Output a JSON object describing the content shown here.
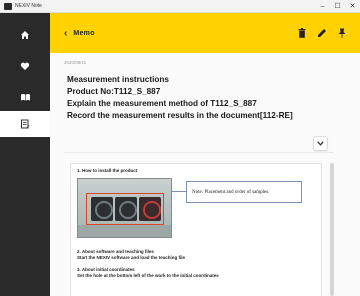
{
  "window": {
    "title": "NEXIV Note",
    "controls": {
      "minimize": "–",
      "maximize": "☐",
      "close": "✕"
    }
  },
  "sidebar": {
    "items": [
      {
        "name": "home",
        "icon": "home-icon",
        "active": false
      },
      {
        "name": "favorites",
        "icon": "heart-icon",
        "active": false
      },
      {
        "name": "library",
        "icon": "books-icon",
        "active": false
      },
      {
        "name": "memo",
        "icon": "memo-icon",
        "active": true
      }
    ]
  },
  "header": {
    "back_icon": "‹",
    "title": "Memo",
    "background": "#ffd200",
    "actions": [
      "trash-icon",
      "edit-icon",
      "pin-icon"
    ]
  },
  "memo": {
    "date": "2020/09/11",
    "lines": [
      "Measurement instructions",
      "Product No:T112_S_887",
      "Explain the measurement method of T112_S_887",
      "Record the measurement results in the document[112-RE]"
    ]
  },
  "document": {
    "section1_title": "1. How to install the product",
    "callout_note": "Note: Placement and order of samples.",
    "section2_title": "2. About software and teaching files",
    "section2_body": "Start the NEXIV software and load the teaching file",
    "section3_title": "3. About initial coordinates",
    "section3_body": "Set the hole at the bottom left of the work to the initial coordinates"
  }
}
